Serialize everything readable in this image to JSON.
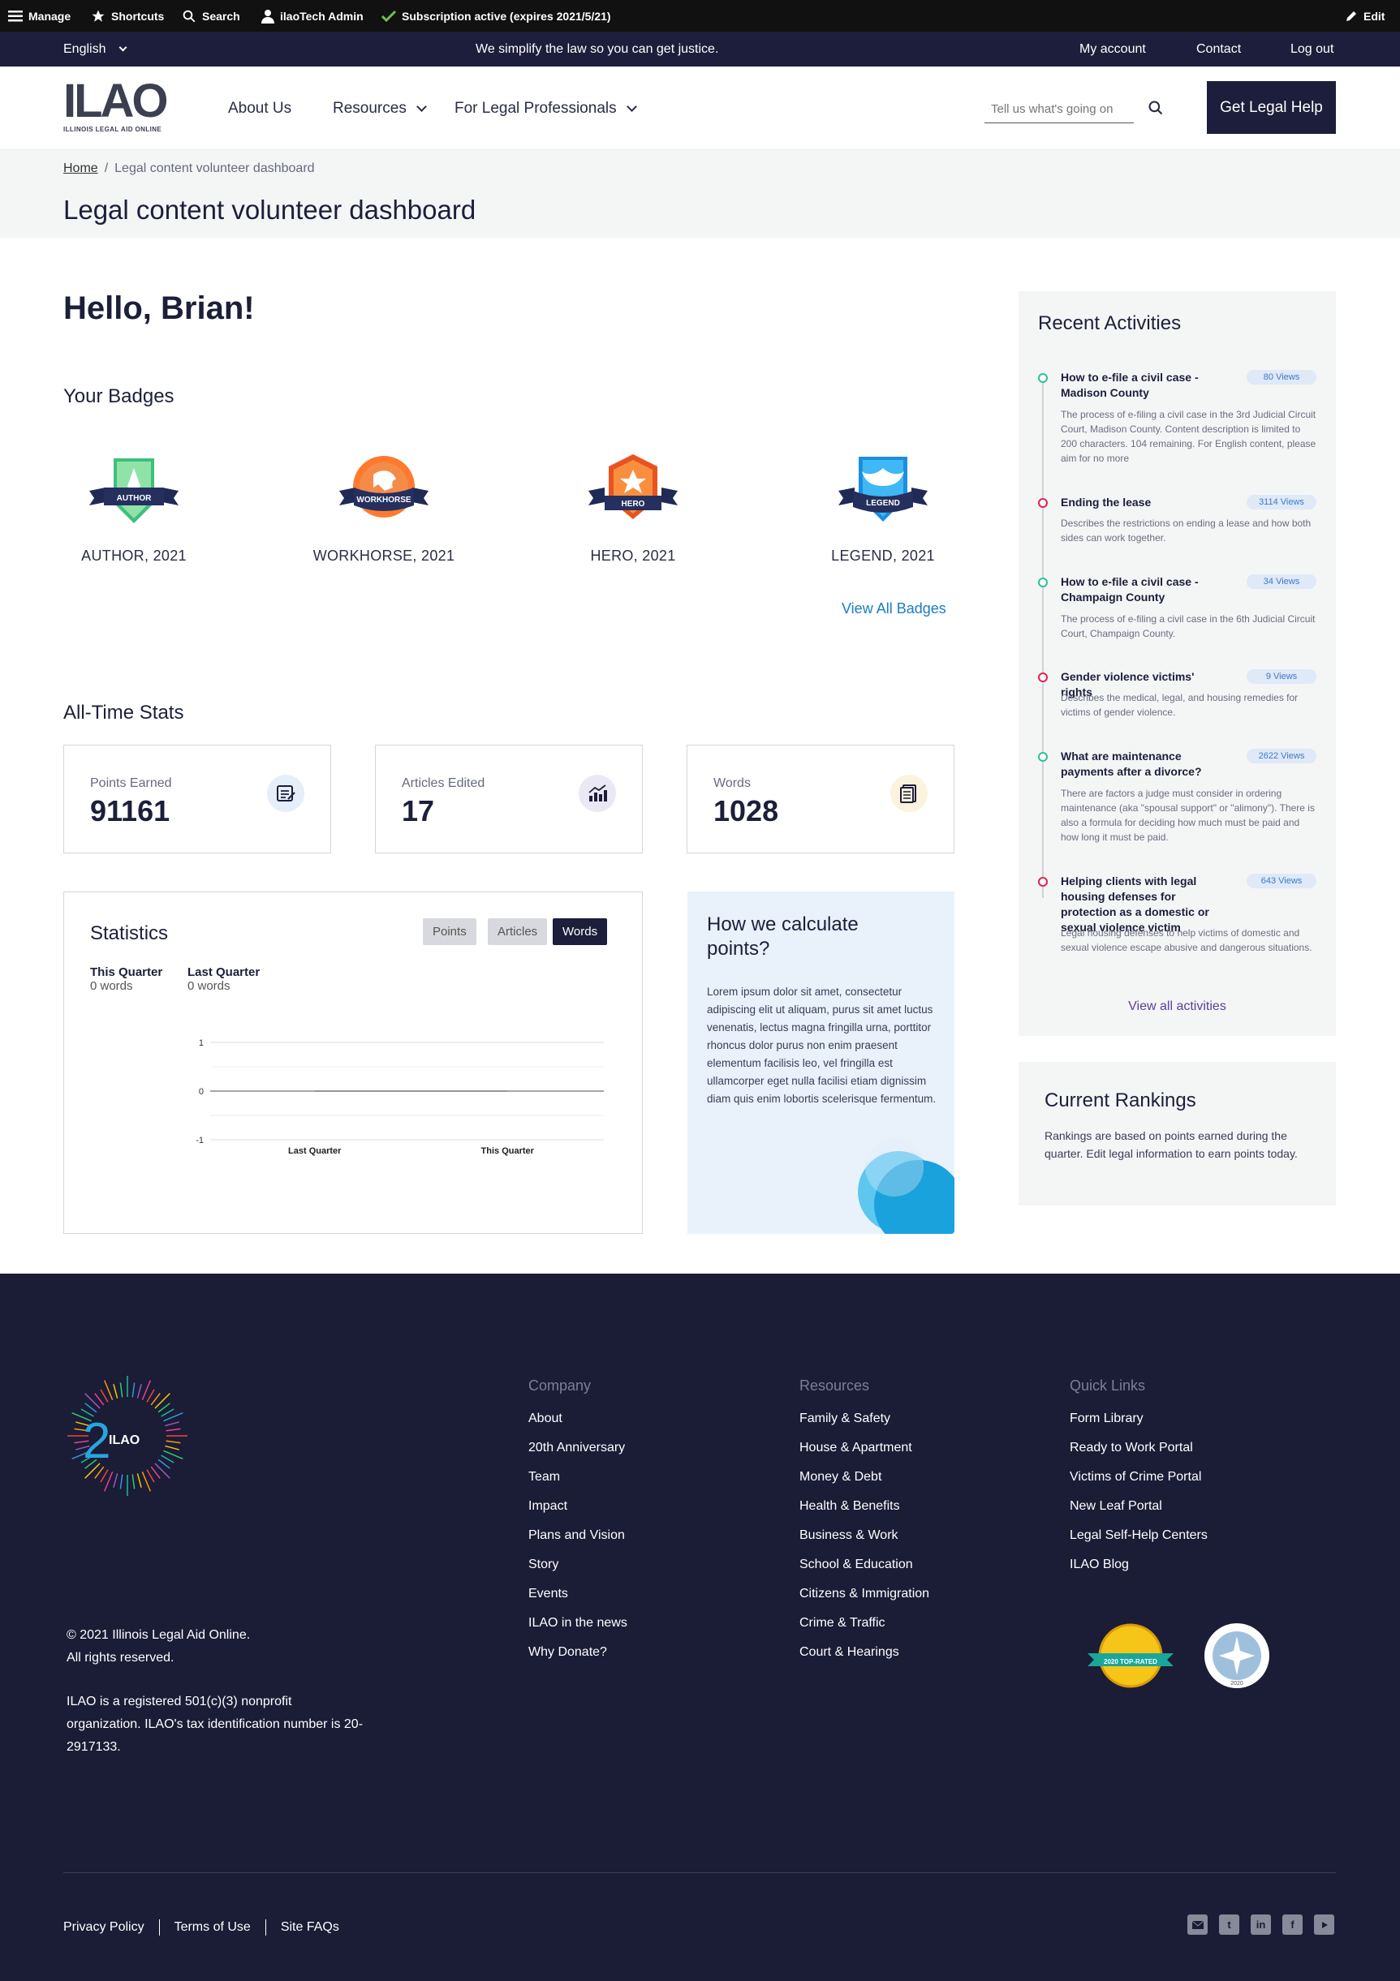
{
  "admin_bar": {
    "manage": "Manage",
    "shortcuts": "Shortcuts",
    "search": "Search",
    "user": "ilaoTech Admin",
    "subscription": "Subscription active (expires 2021/5/21)",
    "edit": "Edit"
  },
  "utility_bar": {
    "language": "English",
    "tagline": "We simplify the law so you can get justice.",
    "links": [
      "My account",
      "Contact",
      "Log out"
    ]
  },
  "header": {
    "logo_text": "ILAO",
    "logo_subtitle": "ILLINOIS LEGAL AID ONLINE",
    "nav": [
      "About Us",
      "Resources",
      "For Legal Professionals"
    ],
    "search_placeholder": "Tell us what's going on",
    "cta": "Get Legal Help"
  },
  "breadcrumb": {
    "home": "Home",
    "separator": "/",
    "current": "Legal content volunteer dashboard"
  },
  "page_title": "Legal content volunteer dashboard",
  "greeting": "Hello, Brian!",
  "badges": {
    "title": "Your Badges",
    "items": [
      {
        "name": "AUTHOR",
        "label": "AUTHOR, 2021",
        "icon": "pen-badge-icon"
      },
      {
        "name": "WORKHORSE",
        "label": "WORKHORSE, 2021",
        "icon": "horse-badge-icon"
      },
      {
        "name": "HERO",
        "label": "HERO, 2021",
        "icon": "star-badge-icon"
      },
      {
        "name": "LEGEND",
        "label": "LEGEND, 2021",
        "icon": "phoenix-badge-icon"
      }
    ],
    "view_all": "View All Badges"
  },
  "all_time_stats": {
    "title": "All-Time Stats",
    "cards": [
      {
        "label": "Points Earned",
        "value": "91161",
        "icon": "points-icon"
      },
      {
        "label": "Articles Edited",
        "value": "17",
        "icon": "chart-icon"
      },
      {
        "label": "Words",
        "value": "1028",
        "icon": "document-icon"
      }
    ]
  },
  "statistics": {
    "title": "Statistics",
    "tabs": [
      "Points",
      "Articles",
      "Words"
    ],
    "active_tab": "Words",
    "this_quarter_label": "This Quarter",
    "this_quarter_value": "0 words",
    "last_quarter_label": "Last Quarter",
    "last_quarter_value": "0 words"
  },
  "chart_data": {
    "type": "line",
    "categories": [
      "Last Quarter",
      "This Quarter"
    ],
    "series": [
      {
        "values": [
          0,
          0
        ]
      }
    ],
    "y_ticks": [
      "1",
      "0",
      "-1"
    ],
    "ylim": [
      -1,
      1
    ],
    "grid": true
  },
  "how_we_calculate": {
    "title": "How we calculate points?",
    "body": "Lorem ipsum dolor sit amet, consectetur adipiscing elit ut aliquam, purus sit amet luctus venenatis, lectus magna fringilla urna, porttitor rhoncus dolor purus non enim praesent elementum facilisis leo, vel fringilla est ullamcorper eget nulla facilisi etiam dignissim diam quis enim lobortis scelerisque fermentum."
  },
  "recent_activities": {
    "title": "Recent Activities",
    "items": [
      {
        "title": "How to e-file a civil case - Madison County",
        "views": "80 Views",
        "status": "green",
        "desc": "The process of e-filing a civil case in the 3rd Judicial Circuit Court, Madison County. Content description is limited to 200 characters. 104 remaining. For English content, please aim for no more"
      },
      {
        "title": "Ending the lease",
        "views": "3114 Views",
        "status": "red",
        "desc": "Describes the restrictions on ending a lease and how both sides can work together."
      },
      {
        "title": "How to e-file a civil case - Champaign County",
        "views": "34 Views",
        "status": "green",
        "desc": "The process of e-filing a civil case in the 6th Judicial Circuit Court, Champaign County."
      },
      {
        "title": "Gender violence victims' rights",
        "views": "9 Views",
        "status": "red",
        "desc": "Describes the medical, legal, and housing remedies for victims of gender violence."
      },
      {
        "title": "What are maintenance payments after a divorce?",
        "views": "2622 Views",
        "status": "green",
        "desc": "There are factors a judge must consider in ordering maintenance (aka \"spousal support\" or \"alimony\"). There is also a formula for deciding how much must be paid and how long it must be paid."
      },
      {
        "title": "Helping clients with legal housing defenses for protection as a domestic or sexual violence victim",
        "views": "643 Views",
        "status": "red",
        "desc": "Legal housing defenses to help victims of domestic and sexual violence escape abusive and dangerous situations."
      }
    ],
    "view_all": "View all activities"
  },
  "current_rankings": {
    "title": "Current Rankings",
    "body": "Rankings are based on points earned during the quarter. Edit legal information to earn points today."
  },
  "footer": {
    "logo_text": "ILAO",
    "anniversary": "2",
    "copyright": "© 2021 Illinois Legal Aid Online.",
    "rights": "All rights reserved.",
    "nonprofit": "ILAO is a registered 501(c)(3) nonprofit organization. ILAO's tax identification number is 20-2917133.",
    "columns": [
      {
        "heading": "Company",
        "links": [
          "About",
          "20th Anniversary",
          "Team",
          "Impact",
          "Plans and Vision",
          "Story",
          "Events",
          "ILAO in the news",
          "Why Donate?"
        ]
      },
      {
        "heading": "Resources",
        "links": [
          "Family & Safety",
          "House & Apartment",
          "Money & Debt",
          "Health & Benefits",
          "Business & Work",
          "School & Education",
          "Citizens & Immigration",
          "Crime & Traffic",
          "Court & Hearings"
        ]
      },
      {
        "heading": "Quick Links",
        "links": [
          "Form Library",
          "Ready to Work Portal",
          "Victims of Crime Portal",
          "New Leaf Portal",
          "Legal Self-Help Centers",
          "ILAO Blog"
        ]
      }
    ],
    "seal_1": "2020 TOP-RATED",
    "seal_2": "2020",
    "bottom_links": [
      "Privacy Policy",
      "Terms of Use",
      "Site FAQs"
    ],
    "social": [
      "email-icon",
      "twitter-icon",
      "linkedin-icon",
      "facebook-icon",
      "youtube-icon"
    ]
  },
  "colors": {
    "navy": "#1d1e3b",
    "link": "#1a7ec4",
    "green": "#2fbf9b",
    "red": "#e0234e",
    "purple": "#5b3e9e"
  }
}
